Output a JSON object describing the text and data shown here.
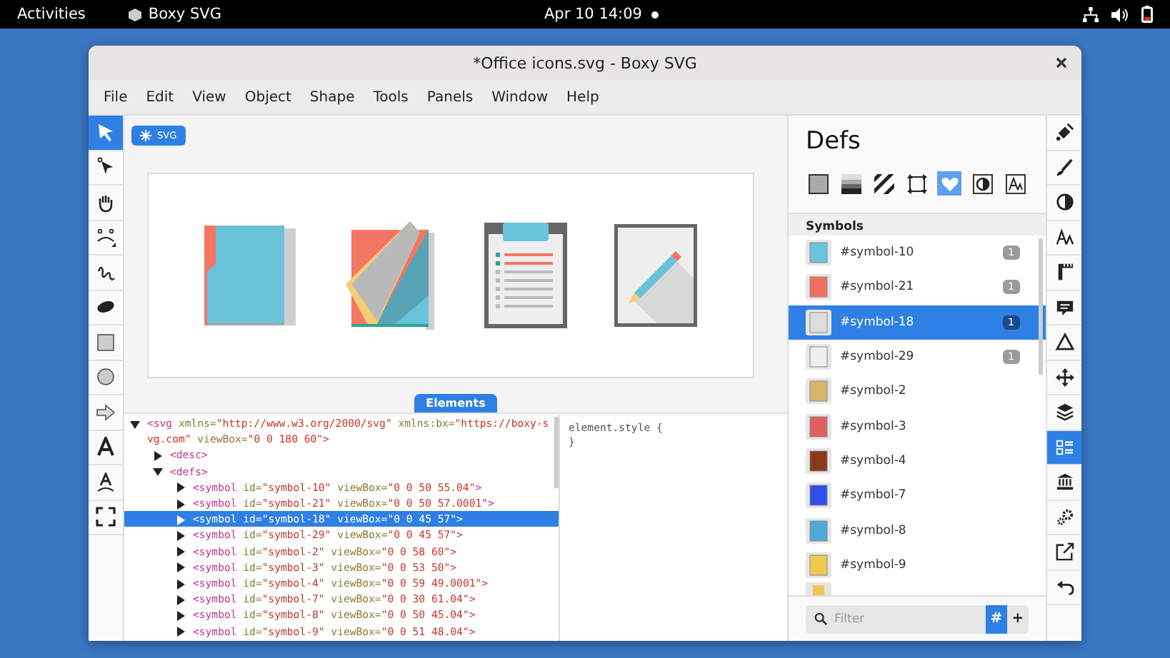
{
  "top_bar": {
    "activities": "Activities",
    "app": "Boxy SVG",
    "clock": "Apr 10  14:09"
  },
  "window": {
    "title": "*Office icons.svg - Boxy SVG"
  },
  "menu": [
    "File",
    "Edit",
    "View",
    "Object",
    "Shape",
    "Tools",
    "Panels",
    "Window",
    "Help"
  ],
  "tools": [
    {
      "kind": "select",
      "selected": true
    },
    {
      "kind": "direct",
      "selected": false
    },
    {
      "kind": "hand",
      "selected": false
    },
    {
      "kind": "morph",
      "selected": false
    },
    {
      "kind": "freehand",
      "selected": false
    },
    {
      "kind": "blob",
      "selected": false
    },
    {
      "kind": "rect",
      "selected": false
    },
    {
      "kind": "ellipse",
      "selected": false
    },
    {
      "kind": "arrow",
      "selected": false
    },
    {
      "kind": "text",
      "selected": false
    },
    {
      "kind": "textpath",
      "selected": false
    },
    {
      "kind": "fullscreen",
      "selected": false
    }
  ],
  "root_chip": "SVG",
  "elements_tab": "Elements",
  "tree": [
    {
      "tokens": [
        {
          "kind": "tag",
          "t": "<svg "
        },
        {
          "kind": "attr",
          "t": "xmlns="
        },
        {
          "kind": "val",
          "t": "\"http://www.w3.org/2000/svg\" "
        },
        {
          "kind": "attr",
          "t": "xmlns:bx="
        },
        {
          "kind": "val",
          "t": "\"https://boxy-svg.com\" "
        },
        {
          "kind": "attr",
          "t": "viewBox="
        },
        {
          "kind": "val",
          "t": "\"0 0 180 60\""
        },
        {
          "kind": "tag",
          "t": ">"
        }
      ],
      "expanded": true,
      "selected": false,
      "children": [
        {
          "tokens": [
            {
              "kind": "tag",
              "t": "<desc>"
            }
          ],
          "expanded": false,
          "selected": false
        },
        {
          "tokens": [
            {
              "kind": "tag",
              "t": "<defs>"
            }
          ],
          "expanded": true,
          "selected": false,
          "children": [
            {
              "tokens": [
                {
                  "kind": "tag",
                  "t": "<symbol "
                },
                {
                  "kind": "attr",
                  "t": "id="
                },
                {
                  "kind": "val",
                  "t": "\"symbol-10\" "
                },
                {
                  "kind": "attr",
                  "t": "viewBox="
                },
                {
                  "kind": "val",
                  "t": "\"0 0 50 55.04\""
                },
                {
                  "kind": "tag",
                  "t": ">"
                }
              ],
              "expanded": false,
              "selected": false
            },
            {
              "tokens": [
                {
                  "kind": "tag",
                  "t": "<symbol "
                },
                {
                  "kind": "attr",
                  "t": "id="
                },
                {
                  "kind": "val",
                  "t": "\"symbol-21\" "
                },
                {
                  "kind": "attr",
                  "t": "viewBox="
                },
                {
                  "kind": "val",
                  "t": "\"0 0 50 57.0001\""
                },
                {
                  "kind": "tag",
                  "t": ">"
                }
              ],
              "expanded": false,
              "selected": false
            },
            {
              "tokens": [
                {
                  "kind": "tag",
                  "t": "<symbol "
                },
                {
                  "kind": "attr",
                  "t": "id="
                },
                {
                  "kind": "val",
                  "t": "\"symbol-18\" "
                },
                {
                  "kind": "attr",
                  "t": "viewBox="
                },
                {
                  "kind": "val",
                  "t": "\"0 0 45 57\""
                },
                {
                  "kind": "tag",
                  "t": ">"
                }
              ],
              "expanded": false,
              "selected": true
            },
            {
              "tokens": [
                {
                  "kind": "tag",
                  "t": "<symbol "
                },
                {
                  "kind": "attr",
                  "t": "id="
                },
                {
                  "kind": "val",
                  "t": "\"symbol-29\" "
                },
                {
                  "kind": "attr",
                  "t": "viewBox="
                },
                {
                  "kind": "val",
                  "t": "\"0 0 45 57\""
                },
                {
                  "kind": "tag",
                  "t": ">"
                }
              ],
              "expanded": false,
              "selected": false
            },
            {
              "tokens": [
                {
                  "kind": "tag",
                  "t": "<symbol "
                },
                {
                  "kind": "attr",
                  "t": "id="
                },
                {
                  "kind": "val",
                  "t": "\"symbol-2\" "
                },
                {
                  "kind": "attr",
                  "t": "viewBox="
                },
                {
                  "kind": "val",
                  "t": "\"0 0 58 60\""
                },
                {
                  "kind": "tag",
                  "t": ">"
                }
              ],
              "expanded": false,
              "selected": false
            },
            {
              "tokens": [
                {
                  "kind": "tag",
                  "t": "<symbol "
                },
                {
                  "kind": "attr",
                  "t": "id="
                },
                {
                  "kind": "val",
                  "t": "\"symbol-3\" "
                },
                {
                  "kind": "attr",
                  "t": "viewBox="
                },
                {
                  "kind": "val",
                  "t": "\"0 0 53 50\""
                },
                {
                  "kind": "tag",
                  "t": ">"
                }
              ],
              "expanded": false,
              "selected": false
            },
            {
              "tokens": [
                {
                  "kind": "tag",
                  "t": "<symbol "
                },
                {
                  "kind": "attr",
                  "t": "id="
                },
                {
                  "kind": "val",
                  "t": "\"symbol-4\" "
                },
                {
                  "kind": "attr",
                  "t": "viewBox="
                },
                {
                  "kind": "val",
                  "t": "\"0 0 59 49.0001\""
                },
                {
                  "kind": "tag",
                  "t": ">"
                }
              ],
              "expanded": false,
              "selected": false
            },
            {
              "tokens": [
                {
                  "kind": "tag",
                  "t": "<symbol "
                },
                {
                  "kind": "attr",
                  "t": "id="
                },
                {
                  "kind": "val",
                  "t": "\"symbol-7\" "
                },
                {
                  "kind": "attr",
                  "t": "viewBox="
                },
                {
                  "kind": "val",
                  "t": "\"0 0 30 61.04\""
                },
                {
                  "kind": "tag",
                  "t": ">"
                }
              ],
              "expanded": false,
              "selected": false
            },
            {
              "tokens": [
                {
                  "kind": "tag",
                  "t": "<symbol "
                },
                {
                  "kind": "attr",
                  "t": "id="
                },
                {
                  "kind": "val",
                  "t": "\"symbol-8\" "
                },
                {
                  "kind": "attr",
                  "t": "viewBox="
                },
                {
                  "kind": "val",
                  "t": "\"0 0 50 45.04\""
                },
                {
                  "kind": "tag",
                  "t": ">"
                }
              ],
              "expanded": false,
              "selected": false
            },
            {
              "tokens": [
                {
                  "kind": "tag",
                  "t": "<symbol "
                },
                {
                  "kind": "attr",
                  "t": "id="
                },
                {
                  "kind": "val",
                  "t": "\"symbol-9\" "
                },
                {
                  "kind": "attr",
                  "t": "viewBox="
                },
                {
                  "kind": "val",
                  "t": "\"0 0 51 48.04\""
                },
                {
                  "kind": "tag",
                  "t": ">"
                }
              ],
              "expanded": false,
              "selected": false
            }
          ]
        }
      ]
    }
  ],
  "styles": [
    "element.style {",
    "}"
  ],
  "defs": {
    "title": "Defs",
    "tabs": [
      {
        "kind": "color",
        "selected": false
      },
      {
        "kind": "gradient",
        "selected": false
      },
      {
        "kind": "pattern",
        "selected": false
      },
      {
        "kind": "transform",
        "selected": false
      },
      {
        "kind": "symbol",
        "selected": true
      },
      {
        "kind": "mask",
        "selected": false
      },
      {
        "kind": "font",
        "selected": false
      }
    ],
    "section": "Symbols",
    "symbols": [
      {
        "name": "#symbol-10",
        "count": "1",
        "selected": false
      },
      {
        "name": "#symbol-21",
        "count": "1",
        "selected": false
      },
      {
        "name": "#symbol-18",
        "count": "1",
        "selected": true
      },
      {
        "name": "#symbol-29",
        "count": "1",
        "selected": false
      },
      {
        "name": "#symbol-2",
        "selected": false
      },
      {
        "name": "#symbol-3",
        "selected": false
      },
      {
        "name": "#symbol-4",
        "selected": false
      },
      {
        "name": "#symbol-7",
        "selected": false
      },
      {
        "name": "#symbol-8",
        "selected": false
      },
      {
        "name": "#symbol-9",
        "selected": false
      }
    ],
    "filter": {
      "placeholder": "Filter",
      "hash": {
        "label": "#",
        "on": true
      },
      "add": "+"
    }
  },
  "panels": [
    {
      "kind": "fill",
      "selected": false
    },
    {
      "kind": "stroke",
      "selected": false
    },
    {
      "kind": "compositing",
      "selected": false
    },
    {
      "kind": "typography",
      "selected": false
    },
    {
      "kind": "geometry",
      "selected": false
    },
    {
      "kind": "meta",
      "selected": false
    },
    {
      "kind": "arrange",
      "selected": false
    },
    {
      "kind": "transform",
      "selected": false
    },
    {
      "kind": "elements",
      "selected": false
    },
    {
      "kind": "defs",
      "selected": true
    },
    {
      "kind": "library",
      "selected": false
    },
    {
      "kind": "generators",
      "selected": false
    },
    {
      "kind": "export",
      "selected": false
    },
    {
      "kind": "history",
      "selected": false
    }
  ]
}
